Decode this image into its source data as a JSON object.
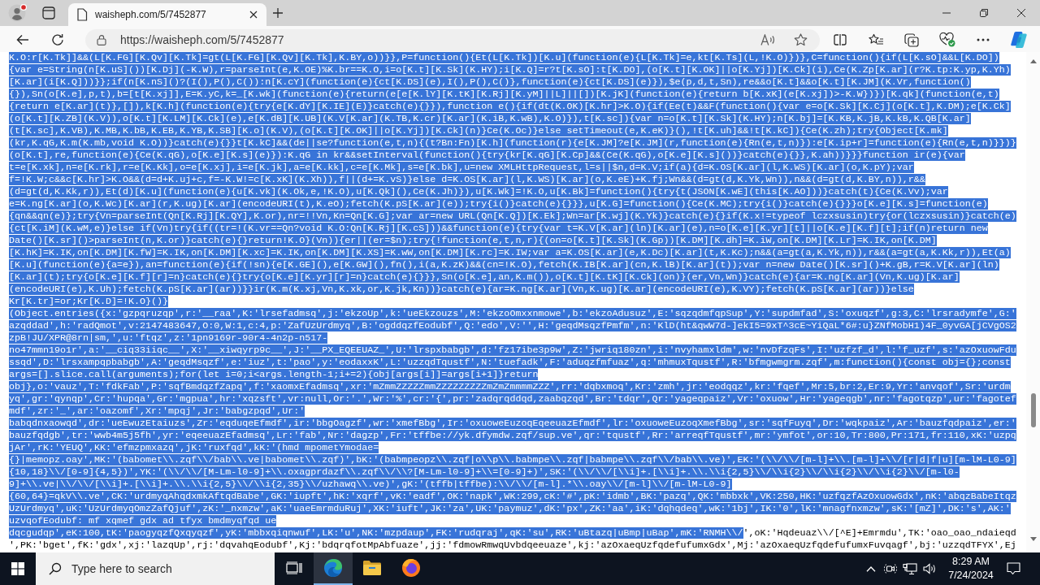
{
  "browser": {
    "tabs": [
      {
        "title": "waisheph.com/5/7452877",
        "selected": true
      }
    ],
    "address_bar": {
      "url": "https://waisheph.com/5/7452877"
    }
  },
  "page": {
    "lines": [
      {
        "spans": [
          {
            "text": "K.O:r[K.Tk]]&&(L[K.FG][K.Qv][K.Tk]=gt(L[K.FG][K.Qv][K.Tk],K.BY,o))}},P=function(){Et(L[K.Tk])[K.u](function(e){L[K.Tk]=e,kt[K.Ts](L,!K.O)})},C=function(){if(L[K.sO]&&L[K.DO])",
            "selected": true
          }
        ]
      },
      {
        "spans": [
          {
            "text": "{var e=String(n[K.uS]())[K.Dj](-K.W),r=parseInt(e,K.OE)%K.br==K.O,i=o[K.t][K.Sk](K.HY);i[K.Q]=r?t[K.sO]:t[K.DO],(o[K.t][K.OK]||o[K.Yj])[K.Ck](i),Ce(K.Zp[K.ar](r?K.tp:K.yp,K.Yh)",
            "selected": true
          }
        ]
      },
      {
        "spans": [
          {
            "text": "[K.ar](i[K.Q]))}};if(n[K.nS]()?(I(),P(),C()):n[K.cY](function(e){ct[K.DS](e),I(),P(),C()},function(e){ct[K.DS](e)}),$e(p,d,t,Sn),re&&o[K.t]&&o[K.t][K.JM](K.Vr,function()",
            "selected": true
          }
        ]
      },
      {
        "spans": [
          {
            "text": "{}),Sn(o[K.e],p,t),b=[t[K.xj]],E=K.yC,k=_[K.wk](function(e){return(e[e[K.lY][K.tK][K.Rj][K.yM]||L]||[])[K.jK](function(e){return b[K.xK](e[K.xj])>-K.W})})[K.qk](function(e,t)",
            "selected": true
          }
        ]
      },
      {
        "spans": [
          {
            "text": "{return e[K.ar](t)},[]),k[K.h](function(e){try{e[K.dY][K.IE](E)}catch(e){}}),function e(){if(dt(K.OK)[K.hr]>K.O){if(Ee(t)&&F(function(){var e=o[K.Sk][K.Cj](o[K.t],K.DM);e[K.Ck]",
            "selected": true
          }
        ]
      },
      {
        "spans": [
          {
            "text": "(o[K.t][K.ZB](K.V)),o[K.t][K.LM][K.Ck](e),e[K.dB][K.UB](K.V[K.ar](K.TB,K.cr)[K.ar](K.iB,K.wB),K.O)}),t[K.sc]){var n=o[K.t][K.Sk](K.HY);n[K.bj]=[K.KB,K.jB,K.kB,K.QB[K.ar]",
            "selected": true
          }
        ]
      },
      {
        "spans": [
          {
            "text": "(t[K.sc],K.VB),K.MB,K.bB,K.EB,K.YB,K.SB][K.o](K.V),(o[K.t][K.OK]||o[K.Yj])[K.Ck](n)}Ce(K.Oc)}else setTimeout(e,K.eK)}(),!t[K.uh]&&!t[K.kC]){Ce(K.zh);try{Object[K.mk]",
            "selected": true
          }
        ]
      },
      {
        "spans": [
          {
            "text": "(kr,K.qG,K.m(K.mb,void K.O))}catch(e){}}t[K.kC]&&(de||se?function(e,t,n){(t?Bn:Fn)[K.h](function(r){e[K.JM]?e[K.JM](r,function(e){Rn(e,t,n)}):e[K.ip+r]=function(e){Rn(e,t,n)}})}",
            "selected": true
          }
        ]
      },
      {
        "spans": [
          {
            "text": "(o[K.t],re,function(e){Ce(K.qG),o[K.e][K.s](e)}):K.qG in kr&&setInterval(function(){try{kr[K.qG][K.Cp]&&(Ce(K.qG),o[K.e][K.s]())}catch(e){}},K.ah))}}}function ir(e){var",
            "selected": true
          }
        ]
      },
      {
        "spans": [
          {
            "text": "t=e[K.xk],n=e[K.rk],r=e[K.Kk],o=e[K.xj],i=e[K.jk],a=e[K.kk],c=e[K.Mk],s=e[K.bk],u=new XMLHttpRequest,l=s||$n,d=K.V;if(a){d=K.OS[K.ar](l,K.WS)[K.ar](o,K.pY);var",
            "selected": true
          }
        ]
      },
      {
        "spans": [
          {
            "text": "f=!K.W;c&&c[K.hr]>K.O&&(d=d+K.uj+c,f=-K.W!=c[K.xK](K.Xh)),f||(d+=K.vS)}else d=K.OS[K.ar](l,K.WS)[K.ar](o,K.eE)+K.fj;Wn&&(d=gt(d,K.Yk,Wn)),n&&(d=gt(d,K.BY,n)),r&&",
            "selected": true
          }
        ]
      },
      {
        "spans": [
          {
            "text": "(d=gt(d,K.Kk,r)),Et(d)[K.u](function(e){u[K.vk](K.Ok,e,!K.O),u[K.Qk](),Ce(K.Jh)}),u[K.Wk]=!K.O,u[K.Bk]=function(){try{t(JSON[K.wE](this[K.AO]))}catch(t){Ce(K.Vv);var",
            "selected": true
          }
        ]
      },
      {
        "spans": [
          {
            "text": "e=K.ng[K.ar](o,K.Wc)[K.ar](r,K.ug)[K.ar](encodeURI(t),K.eO);fetch(K.pS[K.ar](e));try{i()}catch(e){}}},u[K.G]=function(){Ce(K.MC);try{i()}catch(e){}}}o[K.e][K.s]=function(e)",
            "selected": true
          }
        ]
      },
      {
        "spans": [
          {
            "text": "{qn&&qn(e)};try{Vn=parseInt(Qn[K.Rj][K.QY],K.or),nr=!!Vn,Kn=Qn[K.G];var ar=new URL(Qn[K.Q])[K.Ek];Wn=ar[K.wj](K.Yk)}catch(e){}if(K.x!=typeof lczxsusin)try{or(lczxsusin)}catch(e)",
            "selected": true
          }
        ]
      },
      {
        "spans": [
          {
            "text": "{ct[K.iM](K.wM,e)}else if(Vn)try{if((tr=!(K.vr==Qn?void K.O:Qn[K.Rj][K.cS]))&&function(e){try{var t=K.V[K.ar](ln)[K.ar](e),n=o[K.e][K.yr][t]||o[K.e][K.f][t];if(n)return new",
            "selected": true
          }
        ]
      },
      {
        "spans": [
          {
            "text": "Date()[K.sr]()>parseInt(n,K.or)}catch(e){}return!K.O}(Vn)){er||(er=$n);try{!function(e,t,n,r){(on=o[K.t][K.Sk](K.Gp))[K.DM][K.dh]=K.iW,on[K.DM][K.Lr]=K.IK,on[K.DM]",
            "selected": true
          }
        ]
      },
      {
        "spans": [
          {
            "text": "[K.hK]=K.IK,on[K.DM][K.fW]=K.IK,on[K.DM][K.xc]=K.IK,on[K.DM][K.XS]=K.wW,on[K.DM][K.rc]=K.IW;var a=K.OS[K.ar](e,K.Dc)[K.ar](t,K.Kc);n&&(a=gt(a,K.Yk,n)),r&&(a=gt(a,K.Kk,r)),Et(a)",
            "selected": true
          }
        ]
      },
      {
        "spans": [
          {
            "text": "[K.u](function(e){a=e}),an=function(e){if(!sn){e[K.GE](),e[K.GW](),fn(),i(a,K.zK)&&(cn=!K.O),fetch(K.IB[K.ar](cn,K.lB)[K.ar](t));var n=new Date()[K.sr]()+K.gB,r=K.V[K.ar](ln)",
            "selected": true
          }
        ]
      },
      {
        "spans": [
          {
            "text": "[K.ar](t);try{o[K.e][K.f][r]=n}catch(e){}try{o[K.e][K.yr][r]=n}catch(e){}}},Sn(o[K.e],an,K.m()),o[K.t][K.tK][K.Ck](on)}(er,Vn,Wn)}catch(e){ar=K.ng[K.ar](Vn,K.ug)[K.ar]",
            "selected": true
          }
        ]
      },
      {
        "spans": [
          {
            "text": "(encodeURI(e),K.Uh);fetch(K.pS[K.ar](ar))}}ir(K.m(K.xj,Vn,K.xk,or,K.jk,Kn))}catch(e){ar=K.ng[K.ar](Vn,K.ug)[K.ar](encodeURI(e),K.VY);fetch(K.pS[K.ar](ar))}else",
            "selected": true
          }
        ]
      },
      {
        "spans": [
          {
            "text": "Kr[K.tr]=or;Kr[K.D]=!K.O}()}",
            "selected": true
          }
        ]
      },
      {
        "spans": [
          {
            "text": "(Object.entries({x:'gzpqruzqp',r:'__raa',K:'lrsefadmsq',j:'ekzoUp',k:'ueEkzouzs',M:'ekzoOmxxnmowe',b:'ekzoAdusuz',E:'sqzqdmfqpSup',Y:'supdmfad',S:'oxuqzf',g:3,C:'lrsradymfe',G:'",
            "selected": true
          }
        ]
      },
      {
        "spans": [
          {
            "text": "azqddad',h:'radQmot',v:2147483647,O:0,W:1,c:4,p:'ZafUzUrdmyq',B:'ogddqzfEodubf',Q:'edo',V:'',H:'geqdMsqzfPmfm',n:'KlD(ht&qwW7d-]ekI5=9xT^3cE~YiQaL*6#:u}ZNfMobH1)4F_0yvGA[jCVgOS2",
            "selected": true
          }
        ]
      },
      {
        "spans": [
          {
            "text": "zpB!JU/XPR@8rn|sm,',u:'ftqz',z:'1pn9169r-90r4-4n2p-n517-",
            "selected": true
          }
        ]
      },
      {
        "spans": [
          {
            "text": "no47mmn19o1r',a:'__ciq33iiqc__',X:'__xiwqyrp9c__',J:'__PX_EQEEUAZ_',U:'lrspxbabgb',d:'fz17ibe3p9w',Z:'jwriq180zn',i:'nvyhamxldm',w:'nvDfzqFs',I:'uzfzf_d',l:'f_uzf',s:'azOxuowFdu",
            "selected": true
          }
        ]
      },
      {
        "spans": [
          {
            "text": "ssqd',D:'lrsxampqpbabgb',A:'geqdMsqzf',e:'iuz',t:'pao',y:'eodaxxK',L:'uzzqdTqustf',N:'tuefadk',F:'aduqzfmfuaz',q:'mhmuxTqustf',R:'bfmgwmgrm.zqf',m:function(){const obj={};const",
            "selected": true
          }
        ]
      },
      {
        "spans": [
          {
            "text": "args=[].slice.call(arguments);for(let i=0;i<args.length-1;i+=2){obj[args[i]]=args[i+1]}return",
            "selected": true
          }
        ]
      },
      {
        "spans": [
          {
            "text": "obj},o:'vauz',T:'fdkFab',P:'sqfBmdqzfZapq',f:'xaomxEfadmsq',xr:'mZmmZZZZZmmZZZZZZZZZmZmZmmmmZZZ',rr:'dqbxmoq',Kr:'zmh',jr:'eodqqz',kr:'fqef',Mr:5,br:2,Er:9,Yr:'anvqof',Sr:'urdm",
            "selected": true
          }
        ]
      },
      {
        "spans": [
          {
            "text": "yq',gr:'qynqp',Cr:'hupqa',Gr:'mgpua',hr:'xqzsft',vr:null,Or:'.',Wr:'%',cr:'{',pr:'zadqrqddqd,zaabqzqd',Br:'tdqr',Qr:'yageqpaiz',Vr:'oxuow',Hr:'yageqgb',nr:'fagotqzp',ur:'fagotef",
            "selected": true
          }
        ]
      },
      {
        "spans": [
          {
            "text": "mdf',zr:'_',ar:'oazomf',Xr:'mpqj',Jr:'babgzpqd',Ur:'",
            "selected": true
          }
        ]
      },
      {
        "spans": [
          {
            "text": "babqdnxaowqd',dr:'ueEwuzEtaiuzs',Zr:'eqduqeEfmdf',ir:'bbgOagzf',wr:'xmefBbg',Ir:'oxuoweEuzoqEqeeuazEfmdf',lr:'oxuoweEuzoqXmefBbg',sr:'sqfFuyq',Dr:'wqkpaiz',Ar:'bauzfqdpaiz',er:'",
            "selected": true
          }
        ]
      },
      {
        "spans": [
          {
            "text": "bauzfqdgb',tr:'wwb4m5j5fh',yr:'eqeeuazEfadmsq',Lr:'fab',Nr:'dagzp',Fr:'tffbe://yk.dfymdw.zqf/sup.ve',qr:'tqustf',Rr:'arreqfTqustf',mr:'ymfot',or:10,Tr:800,Pr:171,fr:110,xK:'uzpq",
            "selected": true
          }
        ]
      },
      {
        "spans": [
          {
            "text": "jAr',rK:'YEUQ',KK:'efmzpmxazq',jK:'ruxfqd',kK:'(hmd mpometYmodae=",
            "selected": true
          }
        ]
      },
      {
        "spans": [
          {
            "text": "{}|memopz.oay',MK:'(babomet\\\\.zqf\\\\/bab\\\\.ve|babomet\\\\.zqf)',bK:'(babmpeopz\\\\.zqf|o\\\\p\\\\.babmpe\\\\.zqf|babmpe\\\\.zqf\\\\/bab\\\\.ve)',EK:'(\\\\/\\\\/[m-l]+\\\\.[m-l]+\\\\/[r|d|f|u][m-lM-L0-9]",
            "selected": true
          }
        ]
      },
      {
        "spans": [
          {
            "text": "{10,18}\\\\/[0-9]{4,5})',YK:'(\\\\/\\\\/[M-Lm-l0-9]+\\\\.oxagprdazf\\\\.zqf\\\\/\\\\?[M-Lm-l0-9]+\\\\=[0-9]+)',SK:'(\\\\/\\\\/[\\\\i]+.[\\\\i]+.\\\\.\\\\i{2,5}\\\\/\\\\i{2}\\\\/\\\\i{2}\\\\/\\\\i{2}\\\\/[m-l0-",
            "selected": true
          }
        ]
      },
      {
        "spans": [
          {
            "text": "9]+\\\\.ve|\\\\/\\\\/[\\\\i]+.[\\\\i]+.\\\\.\\\\i{2,5}\\\\/\\\\i{2,35}\\\\/uzhawq\\\\.ve)',gK:'(tffb|tffbe):\\\\/\\\\/[m-l].*\\\\.oay\\\\/[m-l]\\\\/[m-lM-L0-9]",
            "selected": true
          }
        ]
      },
      {
        "spans": [
          {
            "text": "{60,64}=qkV\\\\.ve',CK:'urdmyqAhqdxmkAftqdBabe',GK:'iupft',hK:'xqrf',vK:'eadf',OK:'napk',WK:299,cK:'#',pK:'idmb',BK:'pazq',QK:'mbbxk',VK:250,HK:'uzfqzfAzOxuowGdx',nK:'abqzBabeItqz",
            "selected": true
          }
        ]
      },
      {
        "spans": [
          {
            "text": "UzUrdmyq',uK:'UzUrdmyqOmzZafQjuf',zK:'_nxmzw',aK:'uaeEmrmduRuj',XK:'iuft',JK:'za',UK:'paymuz',dK:'px',ZK:'aa',iK:'dqhqdeq',wK:'1bj',IK:'0',lK:'mnagfnxmzw',sK:'[mZ]',DK:'s',AK:'",
            "selected": true
          }
        ]
      },
      {
        "spans": [
          {
            "text": "uzvqofEodubf: mf xqmef gdx ad tfyx bmdmyqfqd ue",
            "selected": true
          }
        ]
      },
      {
        "spans": [
          {
            "text": "dqcgudqp',eK:100,tK:'paogyqzfQxqyqzf',yK:'mbbxqiqnwuf',LK:'u',NK:'mzpdaup',FK:'rudqraj',qK:'su',RK:'uBtazq|uBmp|uBap',mK:'RNMH\\\\/",
            "selected": true
          },
          {
            "text": "',oK:'Hqdeuaz\\\\/[^E]+Emrmdu',TK:'oao_oao_ndaieqd",
            "selected": false
          }
        ]
      },
      {
        "spans": [
          {
            "text": "',PK:'bget',fK:'gdx',xj:'lazqUp',rj:'dqvahqEodubf',Kj:'bdqrqfotMpAbfuaze',jj:'fdmowRmwqUvbdqeeuaze',kj:'azOxaeqUzfqdefufumxGdx',Mj:'azOxaeqUzfqdefufumxFuvqagf',bj:'uzzqdTFYX',Ej",
            "selected": false
          }
        ]
      }
    ]
  },
  "taskbar": {
    "search": {
      "placeholder": "Type here to search"
    },
    "apps": [
      {
        "kind": "task-view",
        "active": false
      },
      {
        "kind": "edge",
        "active": true
      },
      {
        "kind": "file-explorer",
        "active": false
      },
      {
        "kind": "firefox",
        "active": false
      }
    ],
    "clock": {
      "time": "8:29 AM",
      "date": "7/24/2024"
    }
  }
}
